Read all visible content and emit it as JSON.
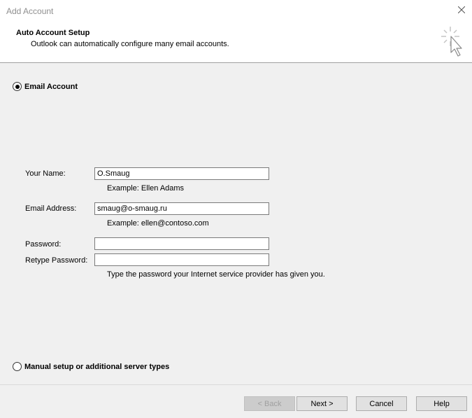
{
  "window": {
    "title": "Add Account"
  },
  "header": {
    "title": "Auto Account Setup",
    "subtitle": "Outlook can automatically configure many email accounts."
  },
  "options": {
    "email_account": {
      "label": "Email Account",
      "selected": true
    },
    "manual_setup": {
      "label": "Manual setup or additional server types",
      "selected": false
    }
  },
  "form": {
    "name": {
      "label": "Your Name:",
      "value": "O.Smaug",
      "hint": "Example: Ellen Adams"
    },
    "email": {
      "label": "Email Address:",
      "value": "smaug@o-smaug.ru",
      "hint": "Example: ellen@contoso.com"
    },
    "password": {
      "label": "Password:",
      "value": ""
    },
    "retype_password": {
      "label": "Retype Password:",
      "value": ""
    },
    "password_hint": "Type the password your Internet service provider has given you."
  },
  "buttons": {
    "back": "< Back",
    "next": "Next >",
    "cancel": "Cancel",
    "help": "Help"
  },
  "icons": {
    "close": "close-icon",
    "header": "cursor-sparkle-icon"
  }
}
